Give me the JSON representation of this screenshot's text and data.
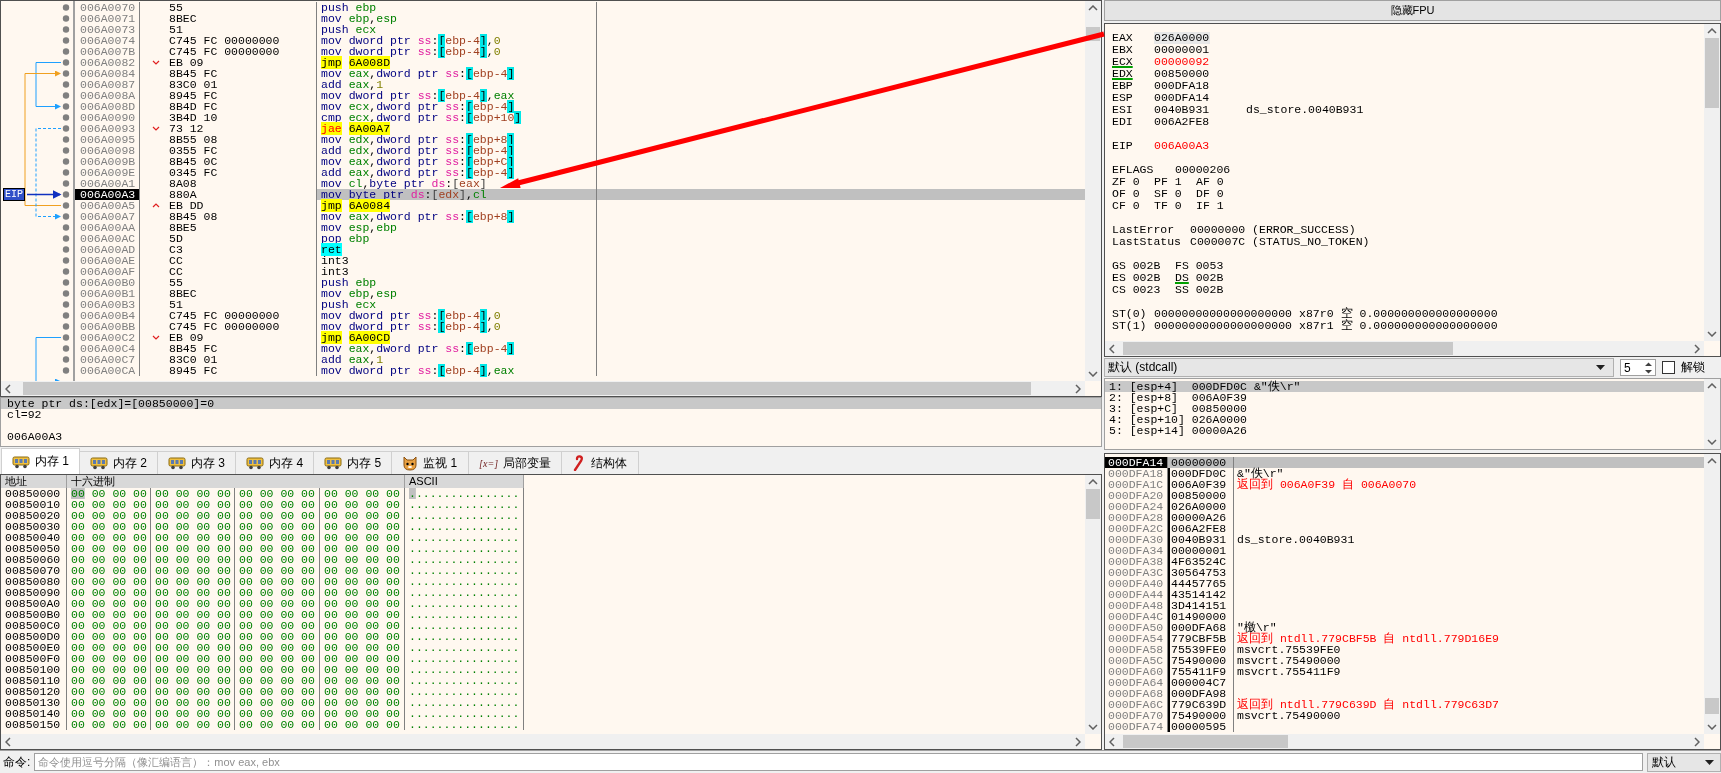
{
  "disassembly": {
    "eip_label": "EIP",
    "rows": [
      {
        "address": "006A0070",
        "bytes": "55",
        "mnemonic": "push",
        "operands": "ebp",
        "kind": "normal",
        "selected": false
      },
      {
        "address": "006A0071",
        "bytes": "8BEC",
        "mnemonic": "mov",
        "operands": "ebp,esp",
        "kind": "normal",
        "selected": false
      },
      {
        "address": "006A0073",
        "bytes": "51",
        "mnemonic": "push",
        "operands": "ecx",
        "kind": "normal",
        "selected": false
      },
      {
        "address": "006A0074",
        "bytes": "C745 FC 00000000",
        "mnemonic": "mov",
        "operands": "dword ptr ss:[ebp-4],0",
        "kind": "normal",
        "selected": false
      },
      {
        "address": "006A007B",
        "bytes": "C745 FC 00000000",
        "mnemonic": "mov",
        "operands": "dword ptr ss:[ebp-4],0",
        "kind": "normal",
        "selected": false
      },
      {
        "address": "006A0082",
        "bytes": "EB 09",
        "mnemonic": "jmp",
        "operands": "6A008D",
        "kind": "jump_down",
        "selected": false
      },
      {
        "address": "006A0084",
        "bytes": "8B45 FC",
        "mnemonic": "mov",
        "operands": "eax,dword ptr ss:[ebp-4]",
        "kind": "normal",
        "selected": false
      },
      {
        "address": "006A0087",
        "bytes": "83C0 01",
        "mnemonic": "add",
        "operands": "eax,1",
        "kind": "normal",
        "selected": false
      },
      {
        "address": "006A008A",
        "bytes": "8945 FC",
        "mnemonic": "mov",
        "operands": "dword ptr ss:[ebp-4],eax",
        "kind": "normal",
        "selected": false
      },
      {
        "address": "006A008D",
        "bytes": "8B4D FC",
        "mnemonic": "mov",
        "operands": "ecx,dword ptr ss:[ebp-4]",
        "kind": "normal",
        "selected": false
      },
      {
        "address": "006A0090",
        "bytes": "3B4D 10",
        "mnemonic": "cmp",
        "operands": "ecx,dword ptr ss:[ebp+10]",
        "kind": "normal",
        "selected": false
      },
      {
        "address": "006A0093",
        "bytes": "73 12",
        "mnemonic": "jae",
        "operands": "6A00A7",
        "kind": "cond_jump_down",
        "selected": false
      },
      {
        "address": "006A0095",
        "bytes": "8B55 08",
        "mnemonic": "mov",
        "operands": "edx,dword ptr ss:[ebp+8]",
        "kind": "normal",
        "selected": false
      },
      {
        "address": "006A0098",
        "bytes": "0355 FC",
        "mnemonic": "add",
        "operands": "edx,dword ptr ss:[ebp-4]",
        "kind": "normal",
        "selected": false
      },
      {
        "address": "006A009B",
        "bytes": "8B45 0C",
        "mnemonic": "mov",
        "operands": "eax,dword ptr ss:[ebp+C]",
        "kind": "normal",
        "selected": false
      },
      {
        "address": "006A009E",
        "bytes": "0345 FC",
        "mnemonic": "add",
        "operands": "eax,dword ptr ss:[ebp-4]",
        "kind": "normal",
        "selected": false
      },
      {
        "address": "006A00A1",
        "bytes": "8A08",
        "mnemonic": "mov",
        "operands": "cl,byte ptr ds:[eax]",
        "kind": "normal",
        "selected": false
      },
      {
        "address": "006A00A3",
        "bytes": "880A",
        "mnemonic": "mov",
        "operands": "byte ptr ds:[edx],cl",
        "kind": "normal",
        "selected": true
      },
      {
        "address": "006A00A5",
        "bytes": "EB DD",
        "mnemonic": "jmp",
        "operands": "6A0084",
        "kind": "jump_up",
        "selected": false
      },
      {
        "address": "006A00A7",
        "bytes": "8B45 08",
        "mnemonic": "mov",
        "operands": "eax,dword ptr ss:[ebp+8]",
        "kind": "normal",
        "selected": false
      },
      {
        "address": "006A00AA",
        "bytes": "8BE5",
        "mnemonic": "mov",
        "operands": "esp,ebp",
        "kind": "normal",
        "selected": false
      },
      {
        "address": "006A00AC",
        "bytes": "5D",
        "mnemonic": "pop",
        "operands": "ebp",
        "kind": "normal",
        "selected": false
      },
      {
        "address": "006A00AD",
        "bytes": "C3",
        "mnemonic": "ret",
        "kind": "return",
        "selected": false
      },
      {
        "address": "006A00AE",
        "bytes": "CC",
        "mnemonic": "int3",
        "kind": "padding",
        "selected": false
      },
      {
        "address": "006A00AF",
        "bytes": "CC",
        "mnemonic": "int3",
        "kind": "padding",
        "selected": false
      },
      {
        "address": "006A00B0",
        "bytes": "55",
        "mnemonic": "push",
        "operands": "ebp",
        "kind": "normal",
        "selected": false
      },
      {
        "address": "006A00B1",
        "bytes": "8BEC",
        "mnemonic": "mov",
        "operands": "ebp,esp",
        "kind": "normal",
        "selected": false
      },
      {
        "address": "006A00B3",
        "bytes": "51",
        "mnemonic": "push",
        "operands": "ecx",
        "kind": "normal",
        "selected": false
      },
      {
        "address": "006A00B4",
        "bytes": "C745 FC 00000000",
        "mnemonic": "mov",
        "operands": "dword ptr ss:[ebp-4],0",
        "kind": "normal",
        "selected": false
      },
      {
        "address": "006A00BB",
        "bytes": "C745 FC 00000000",
        "mnemonic": "mov",
        "operands": "dword ptr ss:[ebp-4],0",
        "kind": "normal",
        "selected": false
      },
      {
        "address": "006A00C2",
        "bytes": "EB 09",
        "mnemonic": "jmp",
        "operands": "6A00CD",
        "kind": "jump_down",
        "selected": false
      },
      {
        "address": "006A00C4",
        "bytes": "8B45 FC",
        "mnemonic": "mov",
        "operands": "eax,dword ptr ss:[ebp-4]",
        "kind": "normal",
        "selected": false
      },
      {
        "address": "006A00C7",
        "bytes": "83C0 01",
        "mnemonic": "add",
        "operands": "eax,1",
        "kind": "normal",
        "selected": false
      },
      {
        "address": "006A00CA",
        "bytes": "8945 FC",
        "mnemonic": "mov",
        "operands": "dword ptr ss:[ebp-4],eax",
        "kind": "normal",
        "selected": false
      }
    ]
  },
  "info": {
    "expression": "byte ptr ds:[edx]=[00850000]=0",
    "value_line": "cl=92",
    "address_line": "006A00A3"
  },
  "tabs": [
    {
      "label": "内存 1",
      "kind": "memory",
      "selected": true
    },
    {
      "label": "内存 2",
      "kind": "memory",
      "selected": false
    },
    {
      "label": "内存 3",
      "kind": "memory",
      "selected": false
    },
    {
      "label": "内存 4",
      "kind": "memory",
      "selected": false
    },
    {
      "label": "内存 5",
      "kind": "memory",
      "selected": false
    },
    {
      "label": "监视 1",
      "kind": "watch",
      "selected": false
    },
    {
      "label": "局部变量",
      "kind": "locals",
      "icon_text": "[x=]",
      "selected": false
    },
    {
      "label": "结构体",
      "kind": "struct",
      "selected": false
    }
  ],
  "dump": {
    "columns": [
      "地址",
      "十六进制",
      "ASCII"
    ],
    "rows": [
      {
        "address": "00850000",
        "groups": [
          "00 00 00 00",
          "00 00 00 00",
          "00 00 00 00",
          "00 00 00 00"
        ],
        "ascii": "................",
        "selected": true
      },
      {
        "address": "00850010",
        "groups": [
          "00 00 00 00",
          "00 00 00 00",
          "00 00 00 00",
          "00 00 00 00"
        ],
        "ascii": "................",
        "selected": false
      },
      {
        "address": "00850020",
        "groups": [
          "00 00 00 00",
          "00 00 00 00",
          "00 00 00 00",
          "00 00 00 00"
        ],
        "ascii": "................",
        "selected": false
      },
      {
        "address": "00850030",
        "groups": [
          "00 00 00 00",
          "00 00 00 00",
          "00 00 00 00",
          "00 00 00 00"
        ],
        "ascii": "................",
        "selected": false
      },
      {
        "address": "00850040",
        "groups": [
          "00 00 00 00",
          "00 00 00 00",
          "00 00 00 00",
          "00 00 00 00"
        ],
        "ascii": "................",
        "selected": false
      },
      {
        "address": "00850050",
        "groups": [
          "00 00 00 00",
          "00 00 00 00",
          "00 00 00 00",
          "00 00 00 00"
        ],
        "ascii": "................",
        "selected": false
      },
      {
        "address": "00850060",
        "groups": [
          "00 00 00 00",
          "00 00 00 00",
          "00 00 00 00",
          "00 00 00 00"
        ],
        "ascii": "................",
        "selected": false
      },
      {
        "address": "00850070",
        "groups": [
          "00 00 00 00",
          "00 00 00 00",
          "00 00 00 00",
          "00 00 00 00"
        ],
        "ascii": "................",
        "selected": false
      },
      {
        "address": "00850080",
        "groups": [
          "00 00 00 00",
          "00 00 00 00",
          "00 00 00 00",
          "00 00 00 00"
        ],
        "ascii": "................",
        "selected": false
      },
      {
        "address": "00850090",
        "groups": [
          "00 00 00 00",
          "00 00 00 00",
          "00 00 00 00",
          "00 00 00 00"
        ],
        "ascii": "................",
        "selected": false
      },
      {
        "address": "008500A0",
        "groups": [
          "00 00 00 00",
          "00 00 00 00",
          "00 00 00 00",
          "00 00 00 00"
        ],
        "ascii": "................",
        "selected": false
      },
      {
        "address": "008500B0",
        "groups": [
          "00 00 00 00",
          "00 00 00 00",
          "00 00 00 00",
          "00 00 00 00"
        ],
        "ascii": "................",
        "selected": false
      },
      {
        "address": "008500C0",
        "groups": [
          "00 00 00 00",
          "00 00 00 00",
          "00 00 00 00",
          "00 00 00 00"
        ],
        "ascii": "................",
        "selected": false
      },
      {
        "address": "008500D0",
        "groups": [
          "00 00 00 00",
          "00 00 00 00",
          "00 00 00 00",
          "00 00 00 00"
        ],
        "ascii": "................",
        "selected": false
      },
      {
        "address": "008500E0",
        "groups": [
          "00 00 00 00",
          "00 00 00 00",
          "00 00 00 00",
          "00 00 00 00"
        ],
        "ascii": "................",
        "selected": false
      },
      {
        "address": "008500F0",
        "groups": [
          "00 00 00 00",
          "00 00 00 00",
          "00 00 00 00",
          "00 00 00 00"
        ],
        "ascii": "................",
        "selected": false
      },
      {
        "address": "00850100",
        "groups": [
          "00 00 00 00",
          "00 00 00 00",
          "00 00 00 00",
          "00 00 00 00"
        ],
        "ascii": "................",
        "selected": false
      },
      {
        "address": "00850110",
        "groups": [
          "00 00 00 00",
          "00 00 00 00",
          "00 00 00 00",
          "00 00 00 00"
        ],
        "ascii": "................",
        "selected": false
      },
      {
        "address": "00850120",
        "groups": [
          "00 00 00 00",
          "00 00 00 00",
          "00 00 00 00",
          "00 00 00 00"
        ],
        "ascii": "................",
        "selected": false
      },
      {
        "address": "00850130",
        "groups": [
          "00 00 00 00",
          "00 00 00 00",
          "00 00 00 00",
          "00 00 00 00"
        ],
        "ascii": "................",
        "selected": false
      },
      {
        "address": "00850140",
        "groups": [
          "00 00 00 00",
          "00 00 00 00",
          "00 00 00 00",
          "00 00 00 00"
        ],
        "ascii": "................",
        "selected": false
      },
      {
        "address": "00850150",
        "groups": [
          "00 00 00 00",
          "00 00 00 00",
          "00 00 00 00",
          "00 00 00 00"
        ],
        "ascii": "................",
        "selected": false
      }
    ]
  },
  "command_bar": {
    "label": "命令:",
    "placeholder": "命令使用逗号分隔（像汇编语言）：mov eax, ebx",
    "mode": "默认"
  },
  "registers": {
    "toggle_label": "隐藏FPU",
    "general": [
      {
        "name": "EAX",
        "value": "026A0000",
        "changed": false,
        "in_use": false,
        "selected": true
      },
      {
        "name": "EBX",
        "value": "00000001",
        "changed": false,
        "in_use": false,
        "selected": false
      },
      {
        "name": "ECX",
        "value": "00000092",
        "changed": true,
        "in_use": true,
        "selected": false
      },
      {
        "name": "EDX",
        "value": "00850000",
        "changed": false,
        "in_use": true,
        "selected": false
      },
      {
        "name": "EBP",
        "value": "000DFA18",
        "changed": false,
        "in_use": false,
        "selected": false
      },
      {
        "name": "ESP",
        "value": "000DFA14",
        "changed": false,
        "in_use": false,
        "selected": false
      },
      {
        "name": "ESI",
        "value": "0040B931",
        "comment": "ds_store.0040B931",
        "changed": false,
        "in_use": false,
        "selected": false
      },
      {
        "name": "EDI",
        "value": "006A2FE8",
        "changed": false,
        "in_use": false,
        "selected": false
      }
    ],
    "eip": {
      "name": "EIP",
      "value": "006A00A3",
      "changed": true,
      "in_use": false,
      "selected": false
    },
    "eflags": {
      "name": "EFLAGS",
      "value": "00000206"
    },
    "flags": [
      {
        "name": "ZF",
        "value": "0"
      },
      {
        "name": "PF",
        "value": "1"
      },
      {
        "name": "AF",
        "value": "0"
      },
      {
        "name": "OF",
        "value": "0"
      },
      {
        "name": "SF",
        "value": "0"
      },
      {
        "name": "DF",
        "value": "0"
      },
      {
        "name": "CF",
        "value": "0"
      },
      {
        "name": "TF",
        "value": "0"
      },
      {
        "name": "IF",
        "value": "1"
      }
    ],
    "status": [
      {
        "name": "LastError",
        "value": "00000000 (ERROR_SUCCESS)"
      },
      {
        "name": "LastStatus",
        "value": "C000007C (STATUS_NO_TOKEN)"
      }
    ],
    "segments": [
      {
        "name": "GS",
        "value": "002B",
        "in_use": false
      },
      {
        "name": "FS",
        "value": "0053",
        "in_use": false
      },
      {
        "name": "ES",
        "value": "002B",
        "in_use": false
      },
      {
        "name": "DS",
        "value": "002B",
        "in_use": true
      },
      {
        "name": "CS",
        "value": "0023",
        "in_use": false
      },
      {
        "name": "SS",
        "value": "002B",
        "in_use": false
      }
    ],
    "fpu": [
      {
        "name": "ST(0)",
        "raw": "00000000000000000000",
        "tag": "x87r0",
        "state": "空",
        "value": "0.000000000000000000"
      },
      {
        "name": "ST(1)",
        "raw": "00000000000000000000",
        "tag": "x87r1",
        "state": "空",
        "value": "0.000000000000000000"
      }
    ]
  },
  "call_args": {
    "convention": "默认 (stdcall)",
    "count": "5",
    "lock_label": "解锁",
    "locked": false,
    "args": [
      {
        "text": "1: [esp+4]  000DFD0C &\"佚\\r\"",
        "selected": true
      },
      {
        "text": "2: [esp+8]  006A0F39",
        "selected": false
      },
      {
        "text": "3: [esp+C]  00850000",
        "selected": false
      },
      {
        "text": "4: [esp+10] 026A0000",
        "selected": false
      },
      {
        "text": "5: [esp+14] 00000A26",
        "selected": false
      }
    ]
  },
  "stack": {
    "rows": [
      {
        "address": "000DFA14",
        "value": "00000000",
        "selected": true
      },
      {
        "address": "000DFA18",
        "value": "000DFD0C",
        "comment": "&\"佚\\r\"",
        "kind": "plain",
        "selected": false
      },
      {
        "address": "000DFA1C",
        "value": "006A0F39",
        "comment": "返回到 006A0F39 自 006A0070",
        "kind": "return",
        "selected": false
      },
      {
        "address": "000DFA20",
        "value": "00850000",
        "selected": false
      },
      {
        "address": "000DFA24",
        "value": "026A0000",
        "selected": false
      },
      {
        "address": "000DFA28",
        "value": "00000A26",
        "selected": false
      },
      {
        "address": "000DFA2C",
        "value": "006A2FE8",
        "selected": false
      },
      {
        "address": "000DFA30",
        "value": "0040B931",
        "comment": "ds_store.0040B931",
        "kind": "plain",
        "selected": false
      },
      {
        "address": "000DFA34",
        "value": "00000001",
        "selected": false
      },
      {
        "address": "000DFA38",
        "value": "4F63524C",
        "selected": false
      },
      {
        "address": "000DFA3C",
        "value": "30564753",
        "selected": false
      },
      {
        "address": "000DFA40",
        "value": "44457765",
        "selected": false
      },
      {
        "address": "000DFA44",
        "value": "43514142",
        "selected": false
      },
      {
        "address": "000DFA48",
        "value": "3D414151",
        "selected": false
      },
      {
        "address": "000DFA4C",
        "value": "01490000",
        "selected": false
      },
      {
        "address": "000DFA50",
        "value": "000DFA68",
        "comment": "\"檄\\r\"",
        "kind": "plain",
        "selected": false
      },
      {
        "address": "000DFA54",
        "value": "779CBF5B",
        "comment": "返回到 ntdll.779CBF5B 自 ntdll.779D16E9",
        "kind": "return",
        "selected": false
      },
      {
        "address": "000DFA58",
        "value": "75539FE0",
        "comment": "msvcrt.75539FE0",
        "kind": "plain",
        "selected": false
      },
      {
        "address": "000DFA5C",
        "value": "75490000",
        "comment": "msvcrt.75490000",
        "kind": "plain",
        "selected": false
      },
      {
        "address": "000DFA60",
        "value": "755411F9",
        "comment": "msvcrt.755411F9",
        "kind": "plain",
        "selected": false
      },
      {
        "address": "000DFA64",
        "value": "000004C7",
        "selected": false
      },
      {
        "address": "000DFA68",
        "value": "000DFA98",
        "selected": false
      },
      {
        "address": "000DFA6C",
        "value": "779C639D",
        "comment": "返回到 ntdll.779C639D 自 ntdll.779C63D7",
        "kind": "return",
        "selected": false
      },
      {
        "address": "000DFA70",
        "value": "75490000",
        "comment": "msvcrt.75490000",
        "kind": "plain",
        "selected": false
      },
      {
        "address": "000DFA74",
        "value": "00000595",
        "selected": false
      }
    ]
  }
}
